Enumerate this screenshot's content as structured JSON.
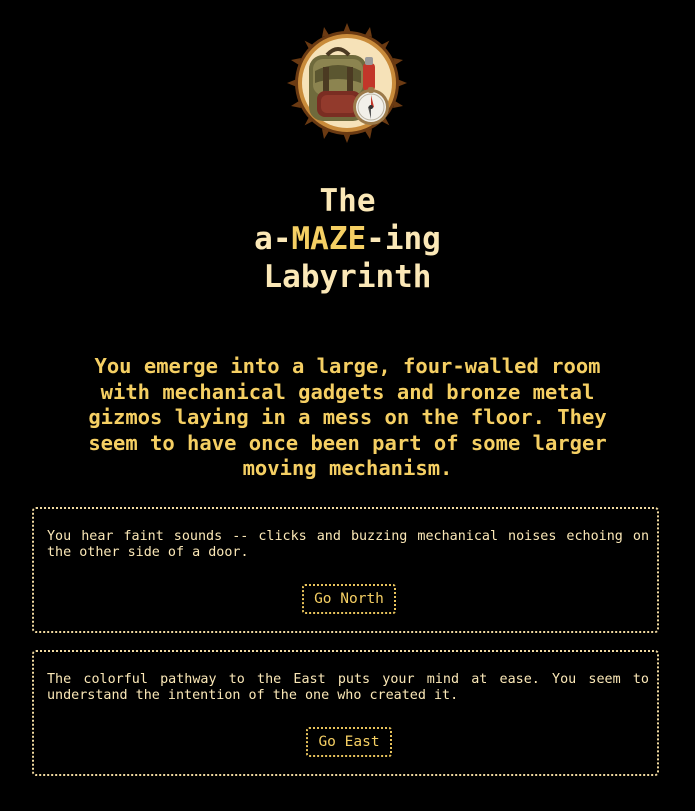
{
  "header": {
    "badge_icon": "backpack-compass-icon"
  },
  "title": {
    "line1": "The",
    "line2_prefix": "a-",
    "line2_accent": "MAZE",
    "line2_suffix": "-ing",
    "line3": "Labyrinth"
  },
  "intro": {
    "text": "You emerge into a large, four-walled room with mechanical gadgets and bronze metal gizmos laying in a mess on the floor. They seem to have once been part of some larger moving mechanism."
  },
  "choices": [
    {
      "text": "You hear faint sounds -- clicks and buzzing mechanical noises echoing on the other side of a door.",
      "button_label": "Go North"
    },
    {
      "text": "The colorful pathway to the East puts your mind at ease. You seem to understand the intention of the one who created it.",
      "button_label": "Go East"
    }
  ],
  "colors": {
    "background": "#000000",
    "text": "#fbe8b7",
    "accent": "#f5cf63",
    "border": "#f0d9a0"
  }
}
